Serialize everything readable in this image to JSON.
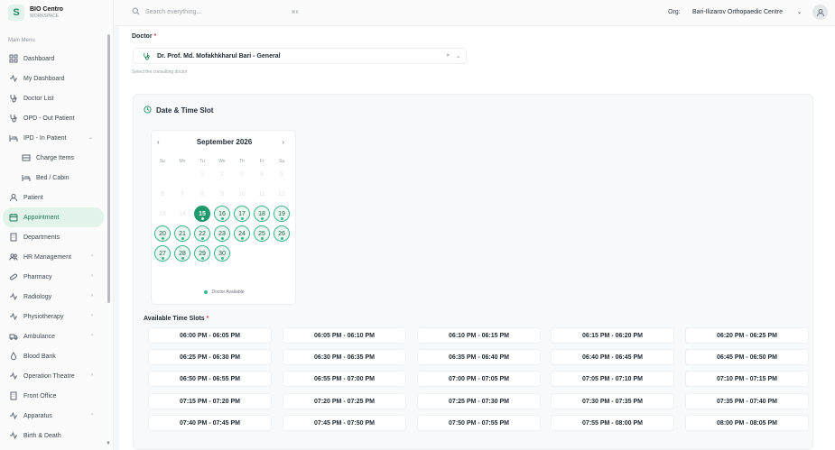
{
  "brand": {
    "name": "BIO Centro",
    "sub": "WORKSPACE",
    "logo": "S"
  },
  "menu_header": "Main Menu",
  "nav": [
    {
      "label": "Dashboard",
      "icon": "grid-icon"
    },
    {
      "label": "My Dashboard",
      "icon": "activity-icon"
    },
    {
      "label": "Doctor List",
      "icon": "stethoscope-icon"
    },
    {
      "label": "OPD - Out Patient",
      "icon": "stethoscope-icon"
    },
    {
      "label": "IPD - In Patient",
      "icon": "bed-icon",
      "chevron": "⌄"
    },
    {
      "label": "Charge Items",
      "icon": "list-icon",
      "sub": true
    },
    {
      "label": "Bed / Cabin",
      "icon": "bed-icon",
      "sub": true
    },
    {
      "label": "Patient",
      "icon": "user-icon"
    },
    {
      "label": "Appointment",
      "icon": "calendar-icon",
      "active": true
    },
    {
      "label": "Departments",
      "icon": "building-icon"
    },
    {
      "label": "HR Management",
      "icon": "users-icon",
      "chevron": "›"
    },
    {
      "label": "Pharmacy",
      "icon": "pill-icon",
      "chevron": "›"
    },
    {
      "label": "Radiology",
      "icon": "activity-icon",
      "chevron": "›"
    },
    {
      "label": "Physiotherapy",
      "icon": "activity-icon",
      "chevron": "›"
    },
    {
      "label": "Ambulance",
      "icon": "ambulance-icon",
      "chevron": "›"
    },
    {
      "label": "Blood Bank",
      "icon": "drop-icon"
    },
    {
      "label": "Operation Theatre",
      "icon": "activity-icon",
      "chevron": "›"
    },
    {
      "label": "Front Office",
      "icon": "building-icon"
    },
    {
      "label": "Apparatus",
      "icon": "activity-icon",
      "chevron": "›"
    },
    {
      "label": "Birth & Death",
      "icon": "activity-icon"
    }
  ],
  "search": {
    "placeholder": "Search everything...",
    "shortcut": "⌘K"
  },
  "org": {
    "label": "Org:",
    "value": "Bari-Ilizarov Orthopaedic Centre",
    "chevron": "⌄"
  },
  "doctor": {
    "label": "Doctor",
    "value": "Dr. Prof. Md. Mofakhkharul Bari - General",
    "hint": "Select the consulting doctor",
    "clear": "×",
    "chevron": "⌄"
  },
  "slot_section": {
    "title": "Date & Time Slot"
  },
  "calendar": {
    "month": "September 2026",
    "prev": "‹",
    "next": "›",
    "weekdays": [
      "Su",
      "Mo",
      "Tu",
      "We",
      "Th",
      "Fr",
      "Sa"
    ],
    "selected": 15,
    "available": [
      16,
      17,
      18,
      19,
      20,
      21,
      22,
      23,
      24,
      25,
      26,
      27,
      28,
      29,
      30
    ],
    "legend": "Doctor Available",
    "accent": "#1f9a6c"
  },
  "times": {
    "label": "Available Time Slots",
    "slots": [
      "06:00 PM - 06:05 PM",
      "06:05 PM - 06:10 PM",
      "06:10 PM - 06:15 PM",
      "06:15 PM - 06:20 PM",
      "06:20 PM - 06:25 PM",
      "06:25 PM - 06:30 PM",
      "06:30 PM - 06:35 PM",
      "06:35 PM - 06:40 PM",
      "06:40 PM - 06:45 PM",
      "06:45 PM - 06:50 PM",
      "06:50 PM - 06:55 PM",
      "06:55 PM - 07:00 PM",
      "07:00 PM - 07:05 PM",
      "07:05 PM - 07:10 PM",
      "07:10 PM - 07:15 PM",
      "07:15 PM - 07:20 PM",
      "07:20 PM - 07:25 PM",
      "07:25 PM - 07:30 PM",
      "07:30 PM - 07:35 PM",
      "07:35 PM - 07:40 PM",
      "07:40 PM - 07:45 PM",
      "07:45 PM - 07:50 PM",
      "07:50 PM - 07:55 PM",
      "07:55 PM - 08:00 PM",
      "08:00 PM - 08:05 PM"
    ]
  }
}
